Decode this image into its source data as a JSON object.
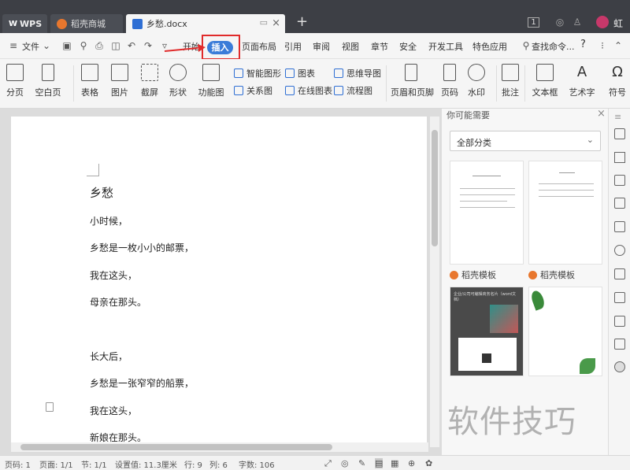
{
  "tabs": {
    "wps": "WPS",
    "daoke": "稻壳商城",
    "doc": "乡愁.docx",
    "badge": "1",
    "user": "虹"
  },
  "menu": {
    "file": "文件",
    "items": [
      "开始",
      "插入",
      "页面布局",
      "引用",
      "审阅",
      "视图",
      "章节",
      "安全",
      "开发工具",
      "特色应用"
    ],
    "search": "查找命令...",
    "help": "?",
    "active": "插入"
  },
  "ribbon": {
    "page_break": "分页",
    "blank_page": "空白页",
    "table": "表格",
    "picture": "图片",
    "screenshot": "截屏",
    "shape": "形状",
    "function_chart": "功能图",
    "smart_graphic": "智能图形",
    "chart": "图表",
    "mind_map": "思维导图",
    "relation": "关系图",
    "online_chart": "在线图表",
    "flowchart": "流程图",
    "header_footer": "页眉和页脚",
    "page_number": "页码",
    "watermark": "水印",
    "comment": "批注",
    "textbox": "文本框",
    "art_text": "艺术字",
    "symbol": "符号"
  },
  "document": {
    "title": "乡愁",
    "lines": [
      "小时候，",
      "乡愁是一枚小小的邮票，",
      "我在这头，",
      "母亲在那头。",
      "长大后，",
      "乡愁是一张窄窄的船票，",
      "我在这头，",
      "新娘在那头。"
    ]
  },
  "panel": {
    "header": "你可能需要",
    "select": "全部分类",
    "template1": "稻壳模板",
    "template2": "稻壳模板",
    "card_text": "企业/公司可编辑商务名片（word文档）"
  },
  "status": {
    "page_code": "页码: 1",
    "pages": "页面: 1/1",
    "section": "节: 1/1",
    "setting": "设置值: 11.3厘米",
    "row": "行: 9",
    "col": "列: 6",
    "words": "字数: 106"
  },
  "watermark_text": "软件技巧",
  "colors": {
    "active_tab": "#3b7cd8",
    "highlight_box": "#e02b2b",
    "titlebar": "#3d3f45"
  }
}
